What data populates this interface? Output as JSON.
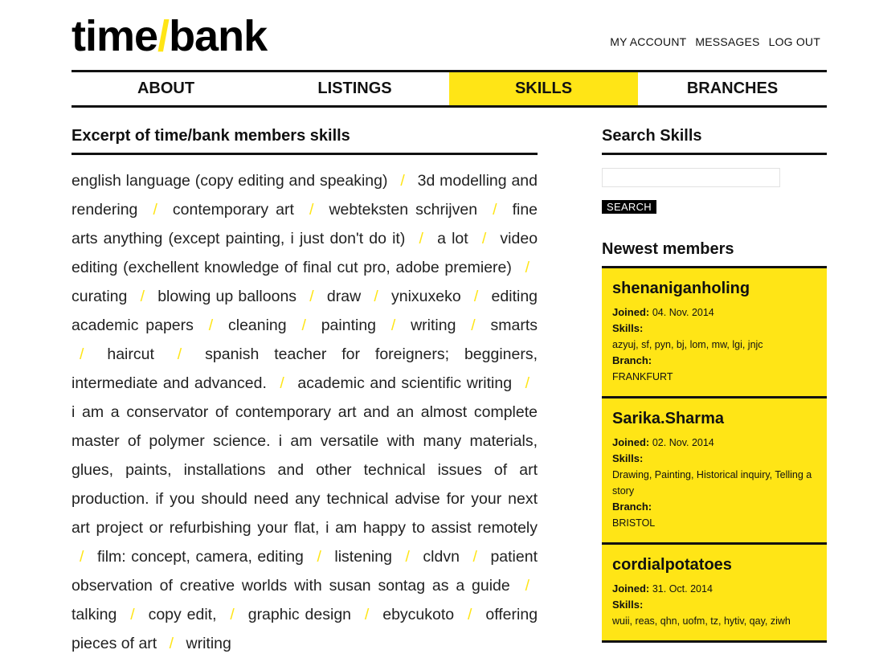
{
  "brand": {
    "part1": "time",
    "slash": "/",
    "part2": "bank"
  },
  "account_nav": [
    "MY ACCOUNT",
    "MESSAGES",
    "LOG OUT"
  ],
  "main_nav": [
    {
      "label": "ABOUT",
      "active": false
    },
    {
      "label": "LISTINGS",
      "active": false
    },
    {
      "label": "SKILLS",
      "active": true
    },
    {
      "label": "BRANCHES",
      "active": false
    }
  ],
  "skills_section": {
    "title": "Excerpt of time/bank members skills",
    "items": [
      "english language (copy editing and speaking)",
      "3d modelling and rendering",
      "contemporary art",
      "webteksten schrijven",
      "fine arts anything (except painting, i just don't do it)",
      "a lot",
      "video editing (exchellent knowledge of final cut pro, adobe premiere)",
      "curating",
      "blowing up balloons",
      "draw",
      "ynixuxeko",
      "editing academic papers",
      "cleaning",
      "painting",
      "writing",
      "smarts",
      "haircut",
      "spanish teacher for foreigners; begginers, intermediate and advanced.",
      "academic and scientific writing",
      "i am a conservator of contemporary art and an almost complete master of polymer science. i am versatile with many materials, glues, paints, installations and other technical issues of art production. if you should need any technical advise for your next art project or refurbishing your flat, i am happy to assist remotely",
      "film: concept, camera, editing",
      "listening",
      "cldvn",
      "patient observation of creative worlds with susan sontag as a guide",
      "talking",
      "copy edit,",
      "graphic design",
      "ebycukoto",
      "offering pieces of art",
      "writing"
    ]
  },
  "search": {
    "title": "Search Skills",
    "placeholder": "",
    "button_label": "SEARCH"
  },
  "newest": {
    "title": "Newest members",
    "labels": {
      "joined": "Joined:",
      "skills": "Skills:",
      "branch": "Branch:"
    },
    "members": [
      {
        "name": "shenaniganholing",
        "joined": "04. Nov. 2014",
        "skills": "azyuj, sf, pyn, bj, lom, mw, lgi, jnjc",
        "branch": "FRANKFURT"
      },
      {
        "name": "Sarika.Sharma",
        "joined": "02. Nov. 2014",
        "skills": "Drawing, Painting, Historical inquiry, Telling a story",
        "branch": "BRISTOL"
      },
      {
        "name": "cordialpotatoes",
        "joined": "31. Oct. 2014",
        "skills": "wuii, reas, qhn, uofm, tz, hytiv, qay, ziwh",
        "branch": ""
      }
    ]
  },
  "colors": {
    "accent": "#ffe516",
    "text": "#111111"
  }
}
